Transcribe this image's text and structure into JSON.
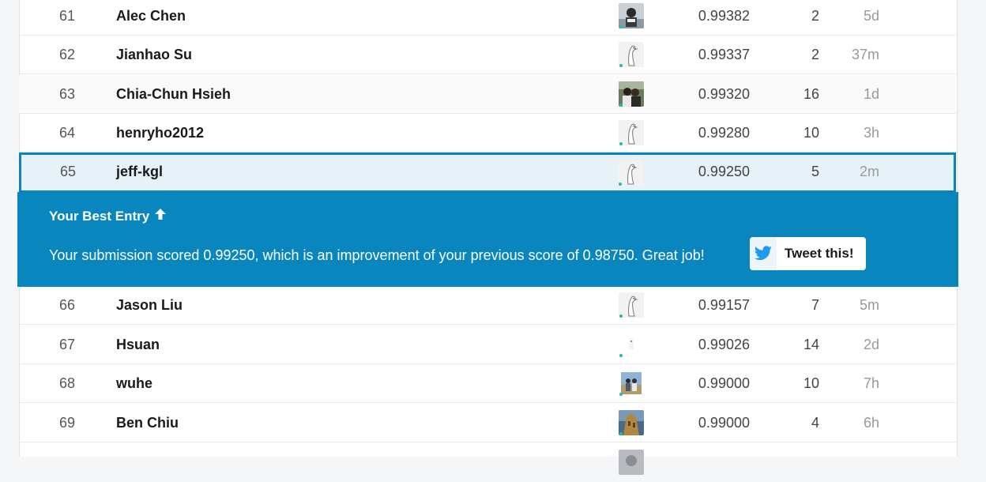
{
  "rows_before": [
    {
      "rank": "61",
      "name": "Alec Chen",
      "score": "0.99382",
      "entries": "2",
      "last": "5d",
      "avatar": "photo-avatar"
    },
    {
      "rank": "62",
      "name": "Jianhao Su",
      "score": "0.99337",
      "entries": "2",
      "last": "37m",
      "avatar": "goose-avatar"
    },
    {
      "rank": "63",
      "name": "Chia-Chun Hsieh",
      "score": "0.99320",
      "entries": "16",
      "last": "1d",
      "avatar": "photo-avatar"
    },
    {
      "rank": "64",
      "name": "henryho2012",
      "score": "0.99280",
      "entries": "10",
      "last": "3h",
      "avatar": "goose-avatar"
    }
  ],
  "my_row": {
    "rank": "65",
    "name": "jeff-kgl",
    "score": "0.99250",
    "entries": "5",
    "last": "2m",
    "avatar": "goose-avatar"
  },
  "banner": {
    "title": "Your Best Entry",
    "arrow_icon": "arrow-up-icon",
    "message": "Your submission scored 0.99250, which is an improvement of your previous score of 0.98750. Great job!",
    "tweet_label": "Tweet this!",
    "tweet_icon": "twitter-icon"
  },
  "rows_after": [
    {
      "rank": "66",
      "name": "Jason Liu",
      "score": "0.99157",
      "entries": "7",
      "last": "5m",
      "avatar": "goose-avatar"
    },
    {
      "rank": "67",
      "name": "Hsuan",
      "score": "0.99026",
      "entries": "14",
      "last": "2d",
      "avatar": "blank-avatar"
    },
    {
      "rank": "68",
      "name": "wuhe",
      "score": "0.99000",
      "entries": "10",
      "last": "7h",
      "avatar": "photo-avatar"
    },
    {
      "rank": "69",
      "name": "Ben Chiu",
      "score": "0.99000",
      "entries": "4",
      "last": "6h",
      "avatar": "photo-avatar"
    }
  ],
  "colors": {
    "accent": "#0a86bf",
    "online_dot": "#20beaa",
    "row_border": "#e6e9eb"
  }
}
